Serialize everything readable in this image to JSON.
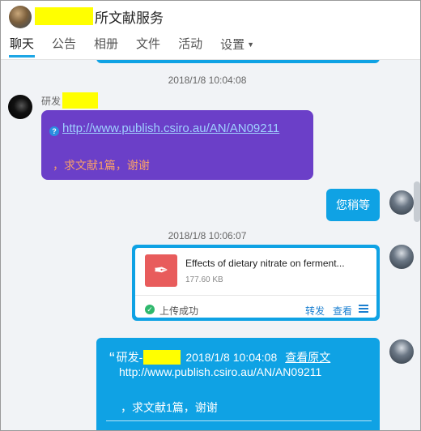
{
  "header": {
    "title": "所文献服务",
    "tabs": [
      {
        "label": "聊天",
        "active": true
      },
      {
        "label": "公告"
      },
      {
        "label": "相册"
      },
      {
        "label": "文件"
      },
      {
        "label": "活动"
      },
      {
        "label": "设置"
      }
    ]
  },
  "chat": {
    "timestamp1": "2018/1/8 10:04:08",
    "msg1": {
      "sender": "研发",
      "link": "http://www.publish.csiro.au/AN/AN09211",
      "text": "，求文献1篇，谢谢"
    },
    "msg2": {
      "text": "您稍等"
    },
    "timestamp2": "2018/1/8 10:06:07",
    "file": {
      "name": "Effects of dietary nitrate on ferment...",
      "size": "177.60 KB",
      "status": "上传成功",
      "forward": "转发",
      "view": "查看"
    },
    "quote": {
      "sender": "研发-",
      "time": "2018/1/8 10:04:08",
      "view_original": "查看原文",
      "link": "http://www.publish.csiro.au/AN/AN09211",
      "text": "，求文献1篇，谢谢"
    }
  },
  "colors": {
    "accent": "#0fa2e4",
    "purple": "#6b3fc8",
    "orange_text": "#f7a06a"
  }
}
